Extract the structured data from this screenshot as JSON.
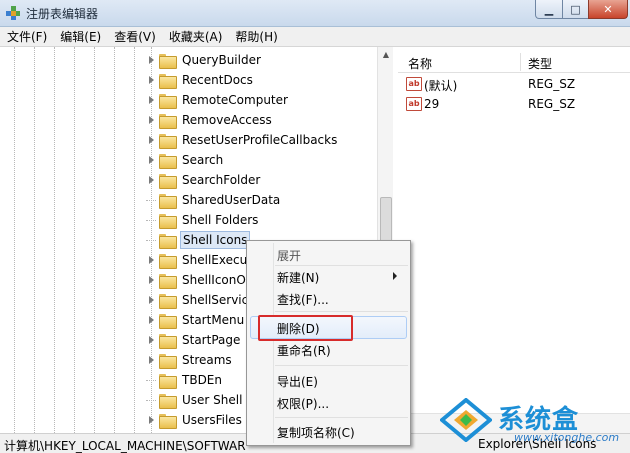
{
  "window": {
    "title": "注册表编辑器"
  },
  "menubar": [
    "文件(F)",
    "编辑(E)",
    "查看(V)",
    "收藏夹(A)",
    "帮助(H)"
  ],
  "tree": {
    "items": [
      {
        "label": "QueryBuilder",
        "has_children": true
      },
      {
        "label": "RecentDocs",
        "has_children": true
      },
      {
        "label": "RemoteComputer",
        "has_children": true
      },
      {
        "label": "RemoveAccess",
        "has_children": true
      },
      {
        "label": "ResetUserProfileCallbacks",
        "has_children": true
      },
      {
        "label": "Search",
        "has_children": true
      },
      {
        "label": "SearchFolder",
        "has_children": true
      },
      {
        "label": "SharedUserData",
        "has_children": false
      },
      {
        "label": "Shell Folders",
        "has_children": false
      },
      {
        "label": "Shell Icons",
        "has_children": false,
        "selected": true
      },
      {
        "label": "ShellExecut",
        "has_children": true
      },
      {
        "label": "ShellIconO",
        "has_children": true
      },
      {
        "label": "ShellService",
        "has_children": true
      },
      {
        "label": "StartMenu",
        "has_children": true
      },
      {
        "label": "StartPage",
        "has_children": true
      },
      {
        "label": "Streams",
        "has_children": true
      },
      {
        "label": "TBDEn",
        "has_children": false
      },
      {
        "label": "User Shell",
        "has_children": false
      },
      {
        "label": "UsersFiles",
        "has_children": true
      }
    ]
  },
  "list": {
    "columns": [
      "名称",
      "类型"
    ],
    "rows": [
      {
        "name": "(默认)",
        "type": "REG_SZ",
        "icon": "reg-string-icon"
      },
      {
        "name": "29",
        "type": "REG_SZ",
        "icon": "reg-string-icon"
      }
    ],
    "icon_text": "ab"
  },
  "context_menu": {
    "items": {
      "expand": "展开",
      "new": "新建(N)",
      "find": "查找(F)...",
      "delete": "删除(D)",
      "rename": "重命名(R)",
      "export": "导出(E)",
      "permissions": "权限(P)...",
      "copy_key_name": "复制项名称(C)"
    }
  },
  "status": {
    "path_visible": "计算机\\HKEY_LOCAL_MACHINE\\SOFTWAR",
    "path_tail": "Explorer\\Shell Icons"
  },
  "watermark": {
    "brand": "系统盒",
    "url": "www.xitonghe.com"
  },
  "colors": {
    "highlight_box": "#d72b2b",
    "brand_blue": "#1d8fd6"
  }
}
